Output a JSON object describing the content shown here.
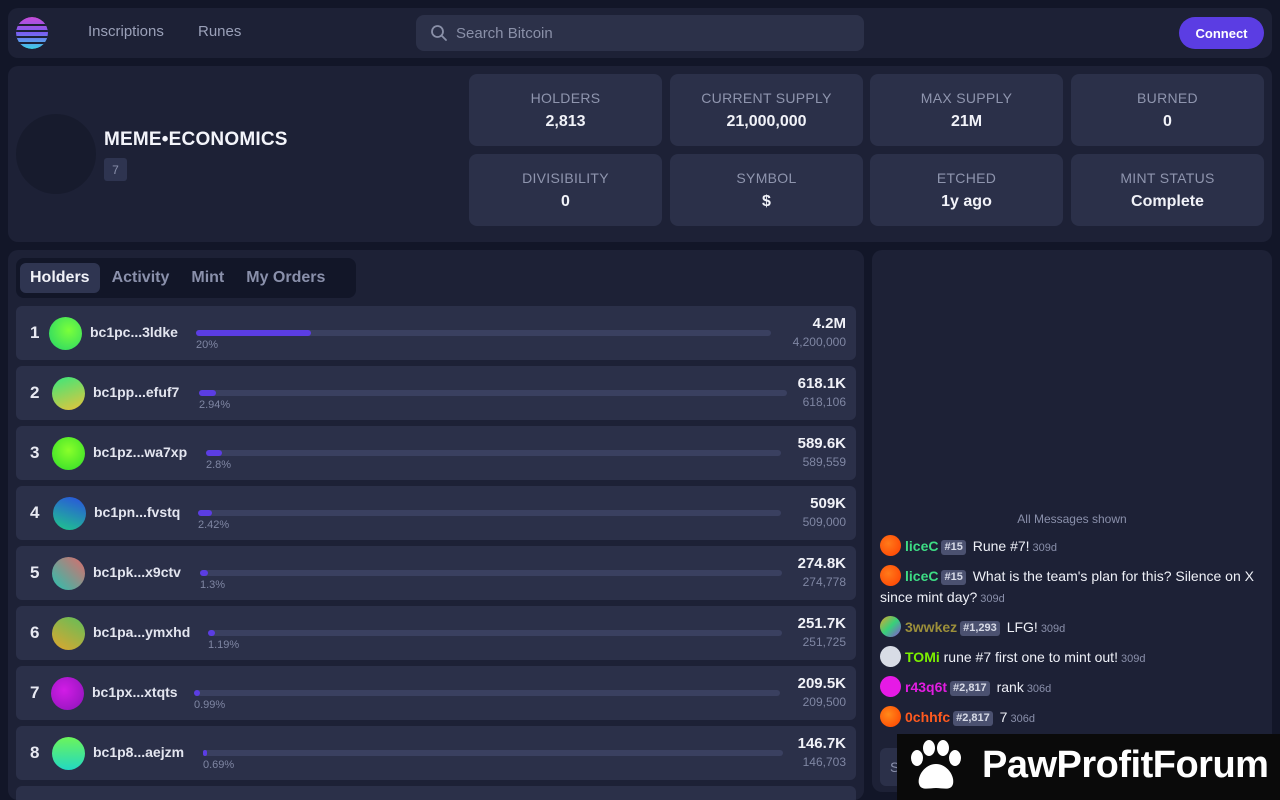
{
  "nav": {
    "links": [
      "Inscriptions",
      "Runes"
    ],
    "search_placeholder": "Search Bitcoin",
    "connect_label": "Connect"
  },
  "rune": {
    "name": "MEME•ECONOMICS",
    "number": "7",
    "stats": [
      {
        "label": "HOLDERS",
        "value": "2,813"
      },
      {
        "label": "CURRENT SUPPLY",
        "value": "21,000,000"
      },
      {
        "label": "MAX SUPPLY",
        "value": "21M"
      },
      {
        "label": "BURNED",
        "value": "0"
      },
      {
        "label": "DIVISIBILITY",
        "value": "0"
      },
      {
        "label": "SYMBOL",
        "value": "$"
      },
      {
        "label": "ETCHED",
        "value": "1y ago"
      },
      {
        "label": "MINT STATUS",
        "value": "Complete"
      }
    ]
  },
  "tabs": [
    "Holders",
    "Activity",
    "Mint",
    "My Orders"
  ],
  "holders": [
    {
      "rank": "1",
      "address": "bc1pc...3ldke",
      "percent": "20%",
      "share": 0.2,
      "amount": "4.2M",
      "amount_full": "4,200,000"
    },
    {
      "rank": "2",
      "address": "bc1pp...efuf7",
      "percent": "2.94%",
      "share": 0.0294,
      "amount": "618.1K",
      "amount_full": "618,106"
    },
    {
      "rank": "3",
      "address": "bc1pz...wa7xp",
      "percent": "2.8%",
      "share": 0.028,
      "amount": "589.6K",
      "amount_full": "589,559"
    },
    {
      "rank": "4",
      "address": "bc1pn...fvstq",
      "percent": "2.42%",
      "share": 0.0242,
      "amount": "509K",
      "amount_full": "509,000"
    },
    {
      "rank": "5",
      "address": "bc1pk...x9ctv",
      "percent": "1.3%",
      "share": 0.013,
      "amount": "274.8K",
      "amount_full": "274,778"
    },
    {
      "rank": "6",
      "address": "bc1pa...ymxhd",
      "percent": "1.19%",
      "share": 0.0119,
      "amount": "251.7K",
      "amount_full": "251,725"
    },
    {
      "rank": "7",
      "address": "bc1px...xtqts",
      "percent": "0.99%",
      "share": 0.0099,
      "amount": "209.5K",
      "amount_full": "209,500"
    },
    {
      "rank": "8",
      "address": "bc1p8...aejzm",
      "percent": "0.69%",
      "share": 0.0069,
      "amount": "146.7K",
      "amount_full": "146,703"
    }
  ],
  "chat": {
    "all_messages_label": "All Messages shown",
    "messages": [
      {
        "user": "liceC",
        "tag": "#15",
        "text": "Rune #7!",
        "time": "309d",
        "user_color": "#3ddc84"
      },
      {
        "user": "liceC",
        "tag": "#15",
        "text": "What is the team's plan for this? Silence on X since mint day?",
        "time": "309d",
        "user_color": "#3ddc84"
      },
      {
        "user": "3wwkez",
        "tag": "#1,293",
        "text": "LFG!",
        "time": "309d",
        "user_color": "#9c8f3a"
      },
      {
        "user": "TOMi",
        "tag": "",
        "text": "rune #7 first one to mint out!",
        "time": "309d",
        "user_color": "#7cf000"
      },
      {
        "user": "r43q6t",
        "tag": "#2,817",
        "text": "rank",
        "time": "306d",
        "user_color": "#e21de0"
      },
      {
        "user": "0chhfc",
        "tag": "#2,817",
        "text": "7",
        "time": "306d",
        "user_color": "#ff5a1f"
      }
    ],
    "input_placeholder": "S"
  },
  "watermark": "PawProfitForum",
  "colors": {
    "accent": "#5b3de3",
    "panel": "#1d2136",
    "background": "#121628"
  }
}
